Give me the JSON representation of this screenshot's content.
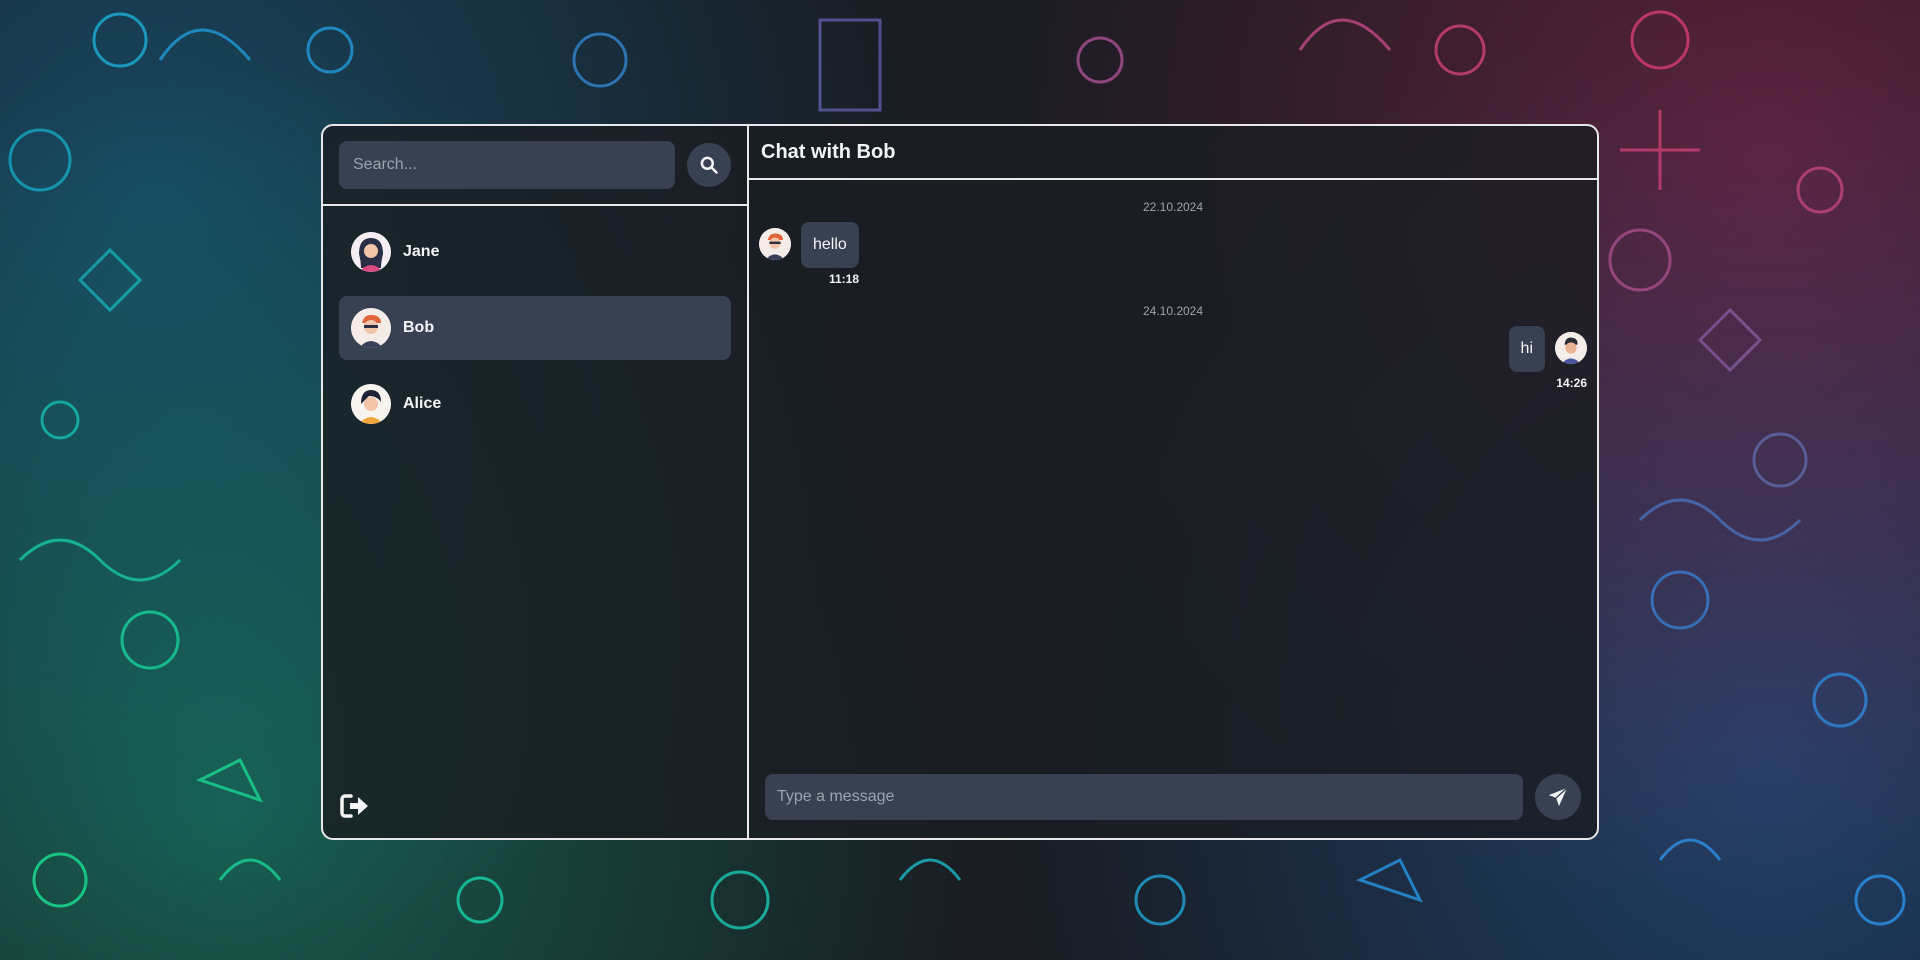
{
  "search": {
    "placeholder": "Search...",
    "icon": "search-icon"
  },
  "contacts": [
    {
      "name": "Jane",
      "active": false,
      "avatar": "avatar-jane"
    },
    {
      "name": "Bob",
      "active": true,
      "avatar": "avatar-bob"
    },
    {
      "name": "Alice",
      "active": false,
      "avatar": "avatar-alice"
    }
  ],
  "sidebar": {
    "logout_icon": "logout-icon"
  },
  "chat": {
    "title": "Chat with Bob",
    "messages": [
      {
        "date": "22.10.2024",
        "text": "hello",
        "time": "11:18",
        "from": "Bob",
        "mine": false
      },
      {
        "date": "24.10.2024",
        "text": "hi",
        "time": "14:26",
        "from": "me",
        "mine": true
      }
    ],
    "input_placeholder": "Type a message",
    "send_icon": "send-icon"
  },
  "colors": {
    "panel_border": "#e8e8ea",
    "input_bg": "#374151",
    "text": "#f3f4f6",
    "muted": "#9ca3af"
  }
}
